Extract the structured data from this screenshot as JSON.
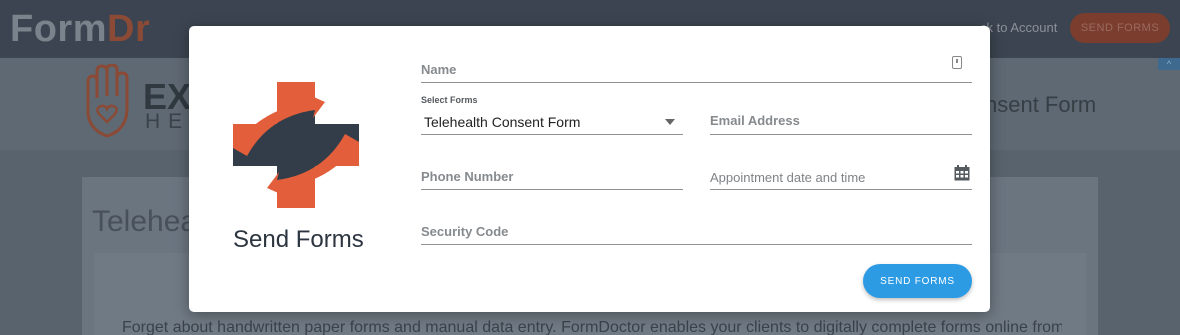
{
  "background": {
    "logo_form": "Form",
    "logo_dr": "Dr",
    "back_link": "ck to Account",
    "send_forms_button": "SEND FORMS",
    "brand_partial": "EX",
    "brand_sub": "HEA",
    "hero_title": "nsent Form",
    "card_title": "Telehea",
    "card_text": "Forget about handwritten paper forms and manual data entry. FormDoctor enables your clients to digitally complete forms online from any"
  },
  "modal": {
    "title": "Send Forms",
    "name_label": "Name",
    "select_label": "Select Forms",
    "select_value": "Telehealth Consent Form",
    "email_label": "Email Address",
    "phone_label": "Phone Number",
    "appointment_label": "Appointment date and time",
    "security_label": "Security Code",
    "send_button": "SEND FORMS"
  },
  "colors": {
    "accent": "#2d9be3",
    "brand_orange": "#e35f3b",
    "brand_navy": "#333d4a"
  }
}
